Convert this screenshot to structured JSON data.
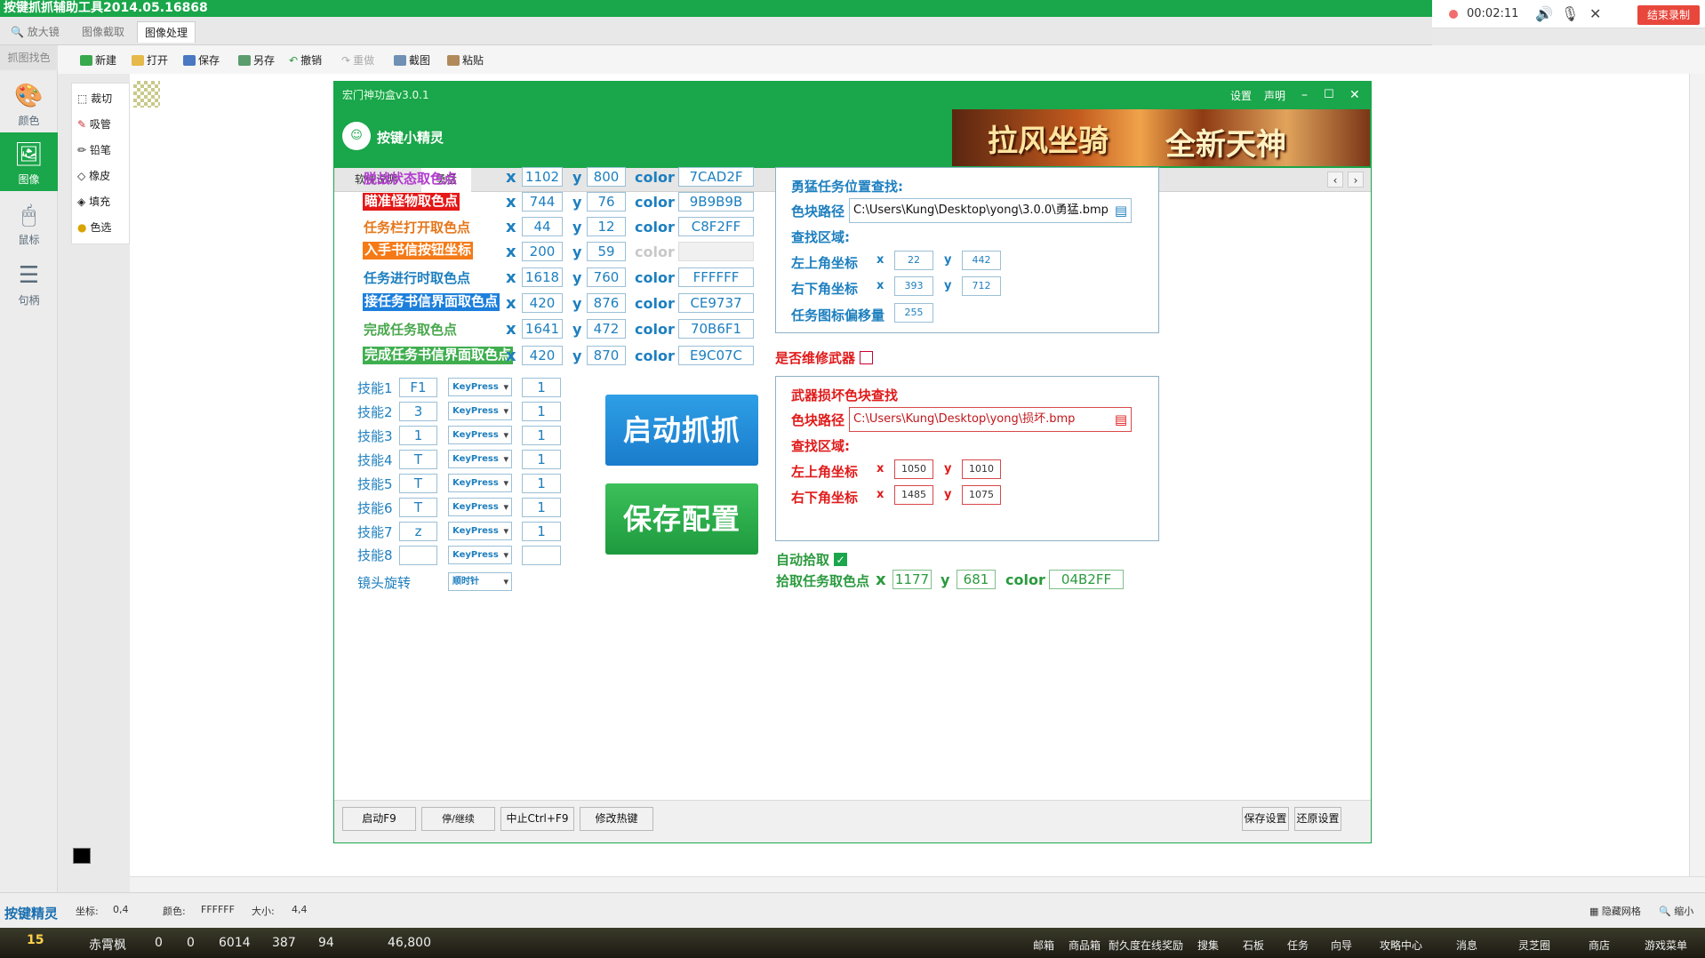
{
  "window": {
    "title": "按键抓抓辅助工具2014.05.16868"
  },
  "recorder": {
    "time": "00:02:11",
    "stop_label": "结束录制"
  },
  "top_tabs": [
    "放大镜",
    "图像截取",
    "图像处理"
  ],
  "toolbar": {
    "new": "新建",
    "open": "打开",
    "save": "保存",
    "save_as": "另存",
    "undo": "撤销",
    "redo": "重做",
    "screenshot": "截图",
    "paste": "粘贴"
  },
  "sidebar": {
    "grab": "抓图找色",
    "items": [
      "颜色",
      "图像",
      "鼠标",
      "句柄"
    ]
  },
  "palette": [
    "裁切",
    "吸管",
    "铅笔",
    "橡皮",
    "填充",
    "色选"
  ],
  "status": {
    "brand": "按键精灵",
    "coord_label": "坐标:",
    "coord_value": "0,4",
    "color_label": "颜色:",
    "color_value": "FFFFFF",
    "size_label": "大小:",
    "size_value": "4,4",
    "grid": "隐藏网格",
    "zoom": "缩小"
  },
  "taskbar": {
    "player": "赤霄枫",
    "level": "15",
    "vals": [
      "0",
      "0",
      "6014",
      "387",
      "94",
      "46,800"
    ],
    "menus": [
      "邮箱",
      "商品箱",
      "耐久度在线奖励",
      "搜集",
      "石板",
      "任务",
      "向导",
      "攻略中心",
      "消息",
      "灵芝圈",
      "商店",
      "游戏菜单"
    ]
  },
  "dialog": {
    "version": "宏门神功盒v3.0.1",
    "app_name": "按键小精灵",
    "menu_settings": "设置",
    "menu_statement": "声明",
    "banner_left": "拉风坐骑",
    "banner_right": "全新天神",
    "tabs": [
      "软件说明",
      "勇猛"
    ],
    "rows": [
      {
        "label": "脱战状态取色点",
        "x": "1102",
        "y": "800",
        "color": "7CAD2F"
      },
      {
        "label": "瞄准怪物取色点",
        "x": "744",
        "y": "76",
        "color": "9B9B9B"
      },
      {
        "label": "任务栏打开取色点",
        "x": "44",
        "y": "12",
        "color": "C8F2FF"
      },
      {
        "label": "入手书信按钮坐标",
        "x": "200",
        "y": "59",
        "color": ""
      },
      {
        "label": "任务进行时取色点",
        "x": "1618",
        "y": "760",
        "color": "FFFFFF"
      },
      {
        "label": "接任务书信界面取色点",
        "x": "420",
        "y": "876",
        "color": "CE9737"
      },
      {
        "label": "完成任务取色点",
        "x": "1641",
        "y": "472",
        "color": "70B6F1"
      },
      {
        "label": "完成任务书信界面取色点",
        "x": "420",
        "y": "870",
        "color": "E9C07C"
      }
    ],
    "x_label": "x",
    "y_label": "y",
    "color_label": "color",
    "skills": [
      {
        "label": "技能1",
        "key": "F1",
        "mode": "KeyPress",
        "count": "1"
      },
      {
        "label": "技能2",
        "key": "3",
        "mode": "KeyPress",
        "count": "1"
      },
      {
        "label": "技能3",
        "key": "1",
        "mode": "KeyPress",
        "count": "1"
      },
      {
        "label": "技能4",
        "key": "T",
        "mode": "KeyPress",
        "count": "1"
      },
      {
        "label": "技能5",
        "key": "T",
        "mode": "KeyPress",
        "count": "1"
      },
      {
        "label": "技能6",
        "key": "T",
        "mode": "KeyPress",
        "count": "1"
      },
      {
        "label": "技能7",
        "key": "z",
        "mode": "KeyPress",
        "count": "1"
      },
      {
        "label": "技能8",
        "key": "",
        "mode": "KeyPress",
        "count": ""
      }
    ],
    "camera": {
      "label": "镜头旋转",
      "value": "顺时针"
    },
    "start_button": "启动抓抓",
    "save_button": "保存配置",
    "task_search": {
      "title": "勇猛任务位置查找:",
      "path_label": "色块路径",
      "path": "C:\\Users\\Kung\\Desktop\\yong\\3.0.0\\勇猛.bmp",
      "area_label": "查找区域:",
      "tl_label": "左上角坐标",
      "tl_x": "22",
      "tl_y": "442",
      "br_label": "右下角坐标",
      "br_x": "393",
      "br_y": "712",
      "offset_label": "任务图标偏移量",
      "offset": "255"
    },
    "repair_label": "是否维修武器",
    "weapon_search": {
      "title": "武器损坏色块查找",
      "path_label": "色块路径",
      "path": "C:\\Users\\Kung\\Desktop\\yong\\损坏.bmp",
      "area_label": "查找区域:",
      "tl_label": "左上角坐标",
      "tl_x": "1050",
      "tl_y": "1010",
      "br_label": "右下角坐标",
      "br_x": "1485",
      "br_y": "1075"
    },
    "auto_pick": {
      "label": "自动拾取",
      "checked": true
    },
    "pick_task": {
      "label": "拾取任务取色点",
      "x": "1177",
      "y": "681",
      "color": "04B2FF"
    },
    "bottom": {
      "start": "启动F9",
      "pause": "停/继续Pause/Brea",
      "stop": "中止Ctrl+F9",
      "hotkey": "修改热键",
      "save": "保存设置",
      "restore": "还原设置"
    }
  }
}
